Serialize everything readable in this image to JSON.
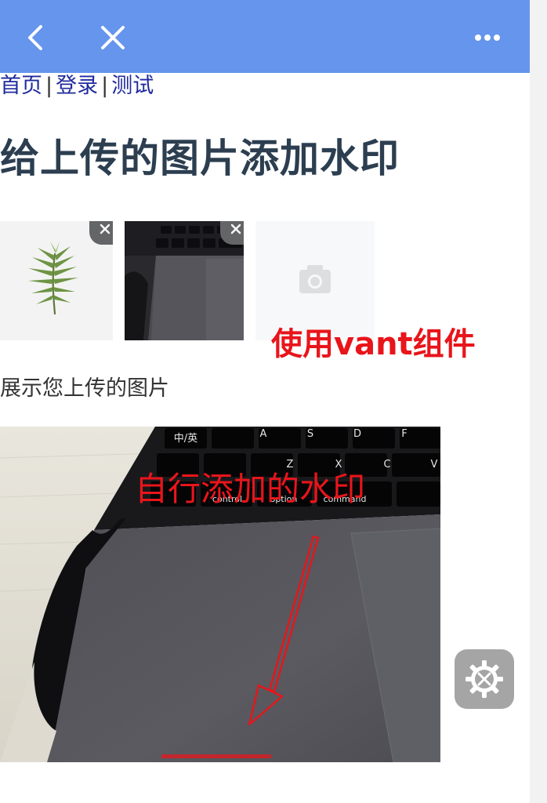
{
  "navbar": {
    "background": "#6595ec",
    "back_icon": "chevron-left-icon",
    "close_icon": "close-icon",
    "more_icon": "more-dots-icon"
  },
  "breadcrumb": {
    "items": [
      "首页",
      "登录",
      "测试"
    ],
    "separator": "|"
  },
  "page": {
    "title": "给上传的图片添加水印"
  },
  "uploader": {
    "files": [
      {
        "name": "fern-leaf-photo"
      },
      {
        "name": "laptop-trackpad-photo"
      }
    ],
    "add_icon": "camera-icon",
    "annotation": "使用vant组件"
  },
  "preview": {
    "label": "展示您上传的图片",
    "annotation": "自行添加的水印",
    "keyboard_keys": [
      "A",
      "S",
      "D",
      "F",
      "Z",
      "X",
      "C",
      "V"
    ],
    "key_labels": [
      "control",
      "option",
      "command"
    ],
    "accent": "#e8151b"
  },
  "floating_button": {
    "icon": "settings-icon"
  }
}
